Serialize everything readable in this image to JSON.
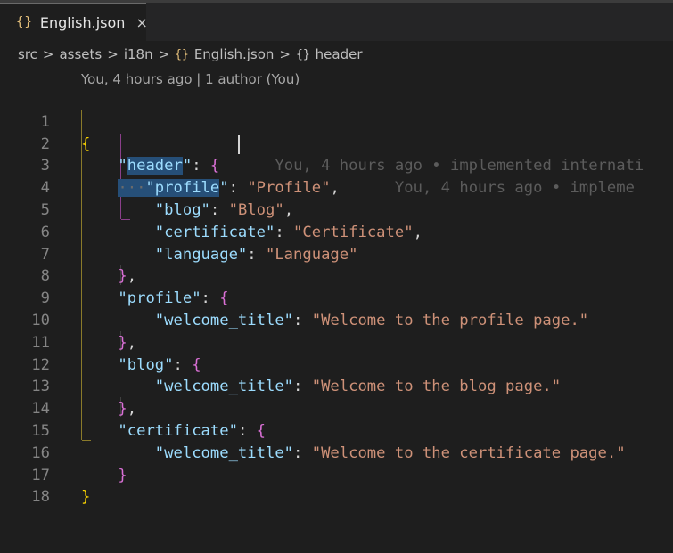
{
  "tab": {
    "icon": "{}",
    "name": "English.json",
    "close": "×"
  },
  "breadcrumb": {
    "items": [
      "src",
      "assets",
      "i18n"
    ],
    "file_icon": "{}",
    "file": "English.json",
    "symbol_icon": "{}",
    "symbol": "header",
    "separator": ">"
  },
  "codelens": "You, 4 hours ago | 1 author (You)",
  "blame": {
    "line2": "You, 4 hours ago • implemented internati",
    "line3": "You, 4 hours ago • impleme"
  },
  "lines": {
    "l1": {
      "num": "1",
      "brace": "{"
    },
    "l2": {
      "num": "2",
      "key": "\"header\"",
      "colon": ": ",
      "brace": "{"
    },
    "l3": {
      "num": "3",
      "key": "\"profile\"",
      "colon": ": ",
      "value": "\"Profile\"",
      "comma": ","
    },
    "l4": {
      "num": "4",
      "key": "\"blog\"",
      "colon": ": ",
      "value": "\"Blog\"",
      "comma": ","
    },
    "l5": {
      "num": "5",
      "key": "\"certificate\"",
      "colon": ": ",
      "value": "\"Certificate\"",
      "comma": ","
    },
    "l6": {
      "num": "6",
      "key": "\"language\"",
      "colon": ": ",
      "value": "\"Language\""
    },
    "l7": {
      "num": "7",
      "brace": "}",
      "comma": ","
    },
    "l8": {
      "num": "8",
      "key": "\"profile\"",
      "colon": ": ",
      "brace": "{"
    },
    "l9": {
      "num": "9",
      "key": "\"welcome_title\"",
      "colon": ": ",
      "value": "\"Welcome to the profile page.\""
    },
    "l10": {
      "num": "10",
      "brace": "}",
      "comma": ","
    },
    "l11": {
      "num": "11",
      "key": "\"blog\"",
      "colon": ": ",
      "brace": "{"
    },
    "l12": {
      "num": "12",
      "key": "\"welcome_title\"",
      "colon": ": ",
      "value": "\"Welcome to the blog page.\""
    },
    "l13": {
      "num": "13",
      "brace": "}",
      "comma": ","
    },
    "l14": {
      "num": "14",
      "key": "\"certificate\"",
      "colon": ": ",
      "brace": "{"
    },
    "l15": {
      "num": "15",
      "key": "\"welcome_title\"",
      "colon": ": ",
      "value": "\"Welcome to the certificate page.\""
    },
    "l16": {
      "num": "16",
      "brace": "}"
    },
    "l17": {
      "num": "17",
      "brace": "}"
    },
    "l18": {
      "num": "18"
    }
  },
  "colors": {
    "background": "#1e1e1e",
    "key": "#9cdcfe",
    "string": "#ce9178",
    "bracket_level1": "#ffd700",
    "bracket_level2": "#da70d6",
    "selection": "#264f78"
  }
}
